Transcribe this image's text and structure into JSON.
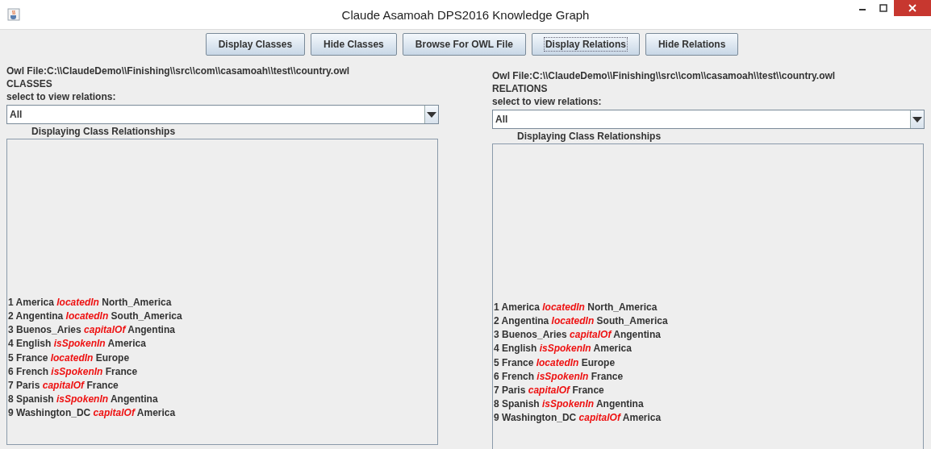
{
  "window": {
    "title": "Claude Asamoah DPS2016 Knowledge Graph"
  },
  "buttons": [
    {
      "label": "Display Classes",
      "focused": false
    },
    {
      "label": "Hide Classes",
      "focused": false
    },
    {
      "label": "Browse For OWL File",
      "focused": false
    },
    {
      "label": "Display Relations",
      "focused": true
    },
    {
      "label": "Hide Relations",
      "focused": false
    }
  ],
  "panels": [
    {
      "file": "Owl File:C:\\\\ClaudeDemo\\\\Finishing\\\\src\\\\com\\\\casamoah\\\\test\\\\country.owl",
      "heading": "CLASSES",
      "select_label": "select to view relations:",
      "dropdown": "All",
      "list_title": "Displaying Class Relationships",
      "rows": [
        "1 America *locatedIn* North_America",
        "2 Angentina *locatedIn* South_America",
        "3 Buenos_Aries *capitalOf* Angentina",
        "4 English *isSpokenIn* America",
        "5 France *locatedIn* Europe",
        "6 French *isSpokenIn* France",
        "7 Paris *capitalOf* France",
        "8 Spanish *isSpokenIn* Angentina",
        "9 Washington_DC *capitalOf* America"
      ]
    },
    {
      "file": "Owl File:C:\\\\ClaudeDemo\\\\Finishing\\\\src\\\\com\\\\casamoah\\\\test\\\\country.owl",
      "heading": "RELATIONS",
      "select_label": "select to view relations:",
      "dropdown": "All",
      "list_title": "Displaying Class Relationships",
      "rows": [
        "1 America *locatedIn* North_America",
        "2 Angentina *locatedIn* South_America",
        "3 Buenos_Aries *capitalOf* Angentina",
        "4 English *isSpokenIn* America",
        "5 France *locatedIn* Europe",
        "6 French *isSpokenIn* France",
        "7 Paris *capitalOf* France",
        "8 Spanish *isSpokenIn* Angentina",
        "9 Washington_DC *capitalOf* America"
      ]
    }
  ]
}
